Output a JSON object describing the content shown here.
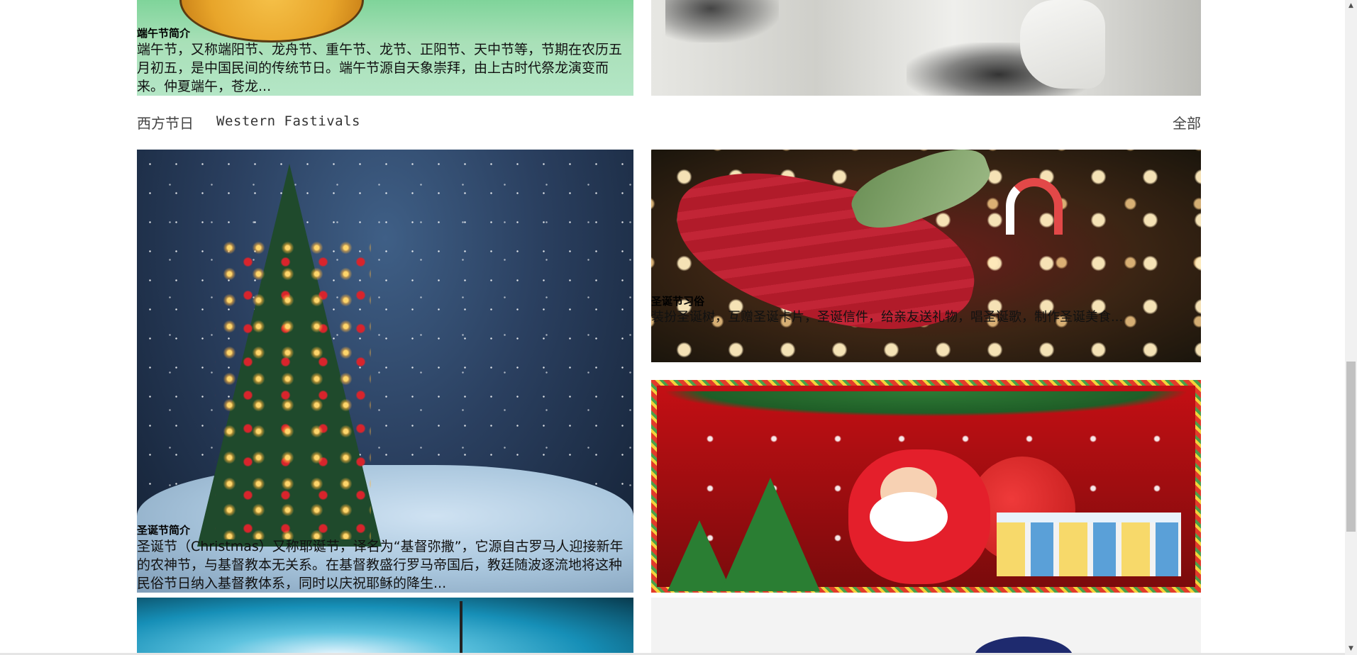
{
  "dragonboat": {
    "title": "端午节简介",
    "text": "端午节，又称端阳节、龙舟节、重午节、龙节、正阳节、天中节等，节期在农历五月初五，是中国民间的传统节日。端午节源自天象崇拜，由上古时代祭龙演变而来。仲夏端午，苍龙..."
  },
  "section": {
    "title_cn": "西方节日",
    "title_en": "Western  Fastivals",
    "all_label": "全部"
  },
  "christmas_intro": {
    "title": "圣诞节简介",
    "text": "圣诞节（Christmas）又称耶诞节，译名为“基督弥撒”，它源自古罗马人迎接新年的农神节，与基督教本无关系。在基督教盛行罗马帝国后，教廷随波逐流地将这种民俗节日纳入基督教体系，同时以庆祝耶稣的降生..."
  },
  "christmas_customs": {
    "title": "圣诞节习俗",
    "text": "装扮圣诞树，互赠圣诞卡片，圣诞信件，给亲友送礼物，唱圣诞歌，制作圣诞美食..."
  },
  "scrollbar": {
    "up_icon": "▲",
    "down_icon": "▼"
  }
}
